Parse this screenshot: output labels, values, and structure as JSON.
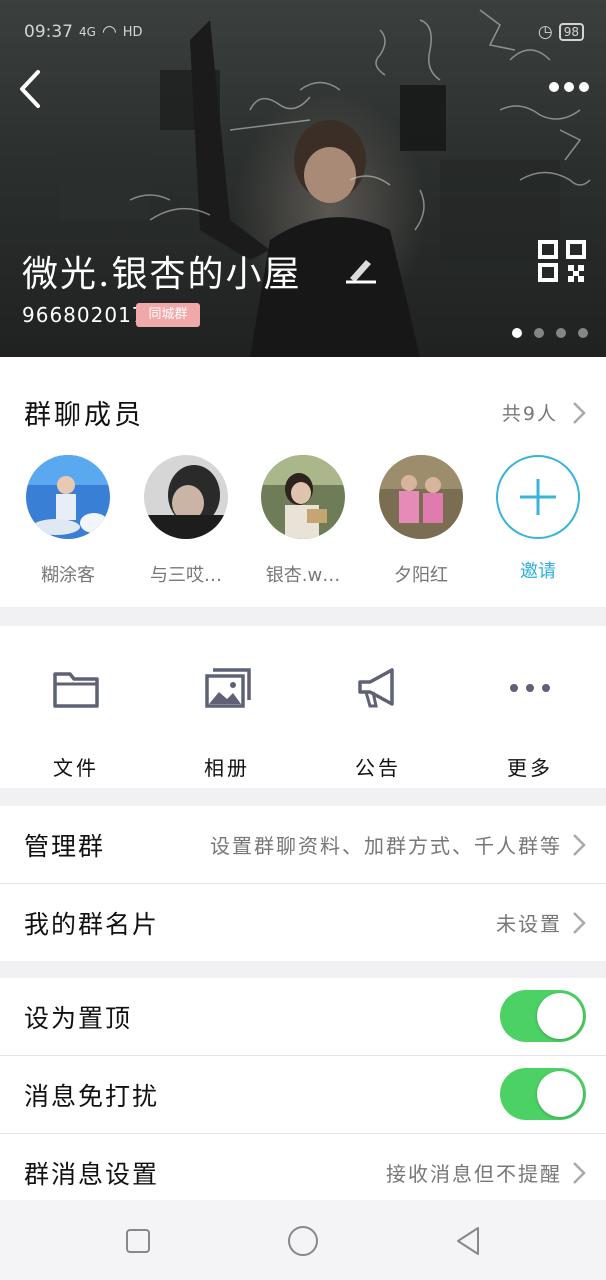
{
  "status_bar": {
    "time": "09:37",
    "signal": "4G",
    "battery": "98",
    "network": "HD"
  },
  "header": {
    "title": "微光.银杏的小屋",
    "group_id": "966802017",
    "tag": "同城群",
    "carousel_dots": 4,
    "active_dot": 0
  },
  "members": {
    "title": "群聊成员",
    "count": "共9人",
    "list": [
      {
        "name": "糊涂客",
        "avatar": "stage-performer"
      },
      {
        "name": "与三哎…",
        "avatar": "man-portrait"
      },
      {
        "name": "银杏.w…",
        "avatar": "woman-reading"
      },
      {
        "name": "夕阳红",
        "avatar": "two-children"
      }
    ],
    "invite_label": "邀请"
  },
  "tools": [
    {
      "label": "文件",
      "icon": "folder-icon"
    },
    {
      "label": "相册",
      "icon": "album-icon"
    },
    {
      "label": "公告",
      "icon": "megaphone-icon"
    },
    {
      "label": "更多",
      "icon": "more-icon"
    }
  ],
  "manage": {
    "manage_label": "管理群",
    "manage_value": "设置群聊资料、加群方式、千人群等",
    "card_label": "我的群名片",
    "card_value": "未设置"
  },
  "settings": {
    "pin_label": "设为置顶",
    "pin_on": true,
    "mute_label": "消息免打扰",
    "mute_on": true,
    "msg_label": "群消息设置",
    "msg_value": "接收消息但不提醒"
  },
  "colors": {
    "accent": "#36b4d9",
    "toggle_on": "#4cd264",
    "tag": "#f1a8a8"
  }
}
